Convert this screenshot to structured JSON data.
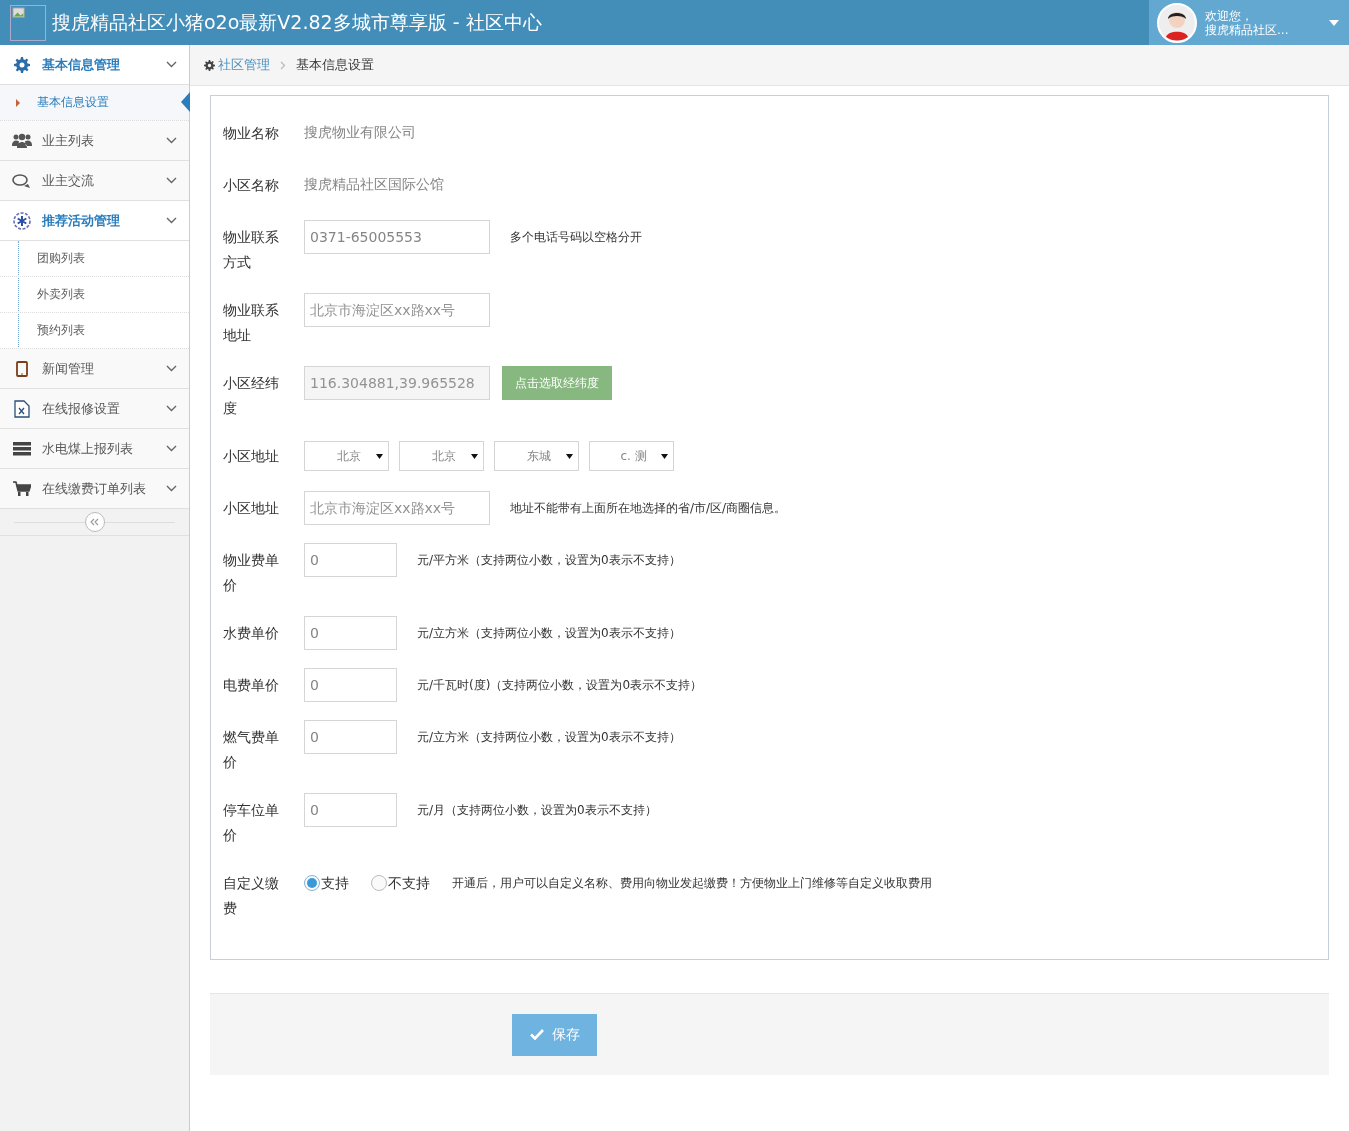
{
  "header": {
    "title": "搜虎精品社区小猪o2o最新V2.82多城市尊享版 - 社区中心",
    "welcome": "欢迎您，",
    "user": "搜虎精品社区..."
  },
  "sidebar": {
    "items": [
      {
        "label": "基本信息管理",
        "selected": true,
        "children": [
          {
            "label": "基本信息设置",
            "selected": true
          }
        ]
      },
      {
        "label": "业主列表",
        "selected": false
      },
      {
        "label": "业主交流",
        "selected": false
      },
      {
        "label": "推荐活动管理",
        "selected": true,
        "children": [
          {
            "label": "团购列表",
            "selected": false
          },
          {
            "label": "外卖列表",
            "selected": false
          },
          {
            "label": "预约列表",
            "selected": false
          }
        ]
      },
      {
        "label": "新闻管理",
        "selected": false
      },
      {
        "label": "在线报修设置",
        "selected": false
      },
      {
        "label": "水电煤上报列表",
        "selected": false
      },
      {
        "label": "在线缴费订单列表",
        "selected": false
      }
    ]
  },
  "breadcrumb": [
    "社区管理",
    "基本信息设置"
  ],
  "form": {
    "rows": [
      {
        "kind": "static",
        "label": "物业名称",
        "value": "搜虎物业有限公司"
      },
      {
        "kind": "static",
        "label": "小区名称",
        "value": "搜虎精品社区国际公馆"
      },
      {
        "kind": "input",
        "label": "物业联系方式",
        "value": "0371-65005553",
        "note": "多个电话号码以空格分开"
      },
      {
        "kind": "input",
        "label": "物业联系地址",
        "placeholder": "北京市海淀区xx路xx号"
      },
      {
        "kind": "readonly",
        "label": "小区经纬度",
        "value": "116.304881,39.965528",
        "button": "点击选取经纬度"
      },
      {
        "kind": "selects",
        "label": "小区地址",
        "options": [
          "北京",
          "北京",
          "东城",
          "c. 测"
        ]
      },
      {
        "kind": "input",
        "label": "小区地址",
        "placeholder": "北京市海淀区xx路xx号",
        "note": "地址不能带有上面所在地选择的省/市/区/商圈信息。"
      },
      {
        "kind": "price",
        "label": "物业费单价",
        "value": "0",
        "note": "元/平方米（支持两位小数，设置为0表示不支持）"
      },
      {
        "kind": "price",
        "label": "水费单价",
        "value": "0",
        "note": "元/立方米（支持两位小数，设置为0表示不支持）"
      },
      {
        "kind": "price",
        "label": "电费单价",
        "value": "0",
        "note": "元/千瓦时(度)（支持两位小数，设置为0表示不支持）"
      },
      {
        "kind": "price",
        "label": "燃气费单价",
        "value": "0",
        "note": "元/立方米（支持两位小数，设置为0表示不支持）"
      },
      {
        "kind": "price",
        "label": "停车位单价",
        "value": "0",
        "note": "元/月（支持两位小数，设置为0表示不支持）"
      },
      {
        "kind": "radio",
        "label": "自定义缴费",
        "choices": [
          {
            "label": "支持",
            "selected": true
          },
          {
            "label": "不支持",
            "selected": false
          }
        ],
        "note": "开通后，用户可以自定义名称、费用向物业发起缴费！方便物业上门维修等自定义收取费用"
      }
    ]
  },
  "save_button": "保存"
}
